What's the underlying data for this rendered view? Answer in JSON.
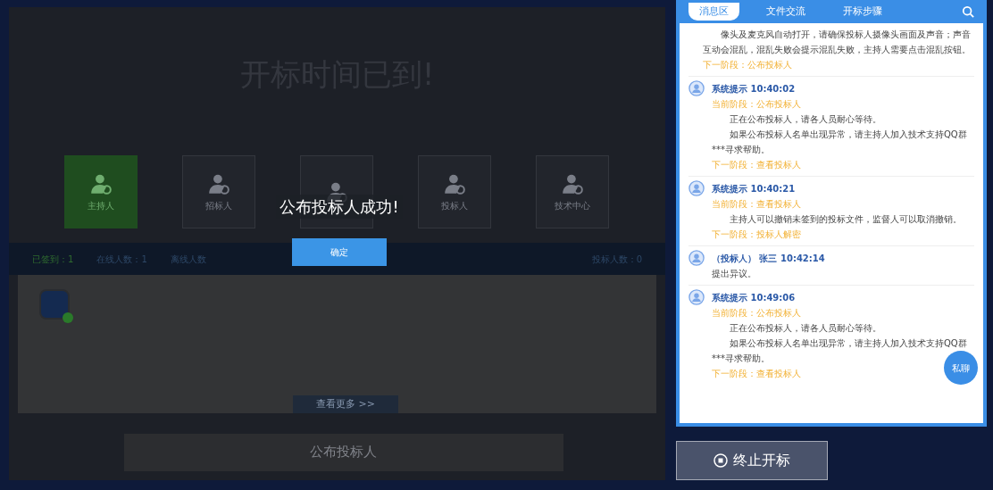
{
  "stage": {
    "title": "开标时间已到!",
    "roles": [
      {
        "label": "主持人",
        "selected": true
      },
      {
        "label": "招标人",
        "selected": false
      },
      {
        "selected": false
      },
      {
        "label": "投标人",
        "selected": false
      },
      {
        "label": "技术中心",
        "selected": false
      }
    ],
    "stats": [
      {
        "kind": "signed",
        "text": "已签到：1"
      },
      {
        "kind": "online",
        "text": "在线人数：1"
      },
      {
        "kind": "offline",
        "text": "离线人数"
      },
      {
        "kind": "bidders",
        "text": "投标人数：0"
      }
    ],
    "bidders": [
      {
        "online": true
      }
    ],
    "more_button": "查看更多 >>",
    "publish_button": "公布投标人"
  },
  "dialog": {
    "message": "公布投标人成功!",
    "button": "确定"
  },
  "chat": {
    "tabs": [
      {
        "label": "消息区",
        "selected": true
      },
      {
        "label": "文件交流",
        "selected": false
      },
      {
        "label": "开标步骤",
        "selected": false
      }
    ],
    "messages": [
      {
        "kind": "partial",
        "lines": [
          {
            "kind": "body",
            "text": "像头及麦克风自动打开，请确保投标人摄像头画面及声音；声音互动会混乱，混乱失败会提示混乱失败，主持人需要点击混乱按钮。"
          },
          {
            "kind": "next",
            "text": "下一阶段：公布投标人"
          }
        ]
      },
      {
        "kind": "system",
        "sender": "系统提示",
        "time": "10:40:02",
        "lines": [
          {
            "kind": "stage",
            "text": "当前阶段：公布投标人"
          },
          {
            "kind": "body",
            "text": "正在公布投标人，请各人员耐心等待。"
          },
          {
            "kind": "body",
            "text": "如果公布投标人名单出现异常，请主持人加入技术支持QQ群***寻求帮助。"
          },
          {
            "kind": "next",
            "text": "下一阶段：查看投标人"
          }
        ]
      },
      {
        "kind": "system",
        "sender": "系统提示",
        "time": "10:40:21",
        "lines": [
          {
            "kind": "stage",
            "text": "当前阶段：查看投标人"
          },
          {
            "kind": "body",
            "text": "主持人可以撤销未签到的投标文件，监督人可以取消撤销。"
          },
          {
            "kind": "next",
            "text": "下一阶段：投标人解密"
          }
        ]
      },
      {
        "kind": "user",
        "sender": "（投标人） 张三",
        "time": "10:42:14",
        "lines": [
          {
            "kind": "plain",
            "text": "提出异议。"
          }
        ]
      },
      {
        "kind": "system",
        "sender": "系统提示",
        "time": "10:49:06",
        "lines": [
          {
            "kind": "stage",
            "text": "当前阶段：公布投标人"
          },
          {
            "kind": "body",
            "text": "正在公布投标人，请各人员耐心等待。"
          },
          {
            "kind": "body",
            "text": "如果公布投标人名单出现异常，请主持人加入技术支持QQ群***寻求帮助。"
          },
          {
            "kind": "next",
            "text": "下一阶段：查看投标人"
          }
        ]
      }
    ],
    "private_chat_button": "私聊"
  },
  "stop_button": "终止开标"
}
